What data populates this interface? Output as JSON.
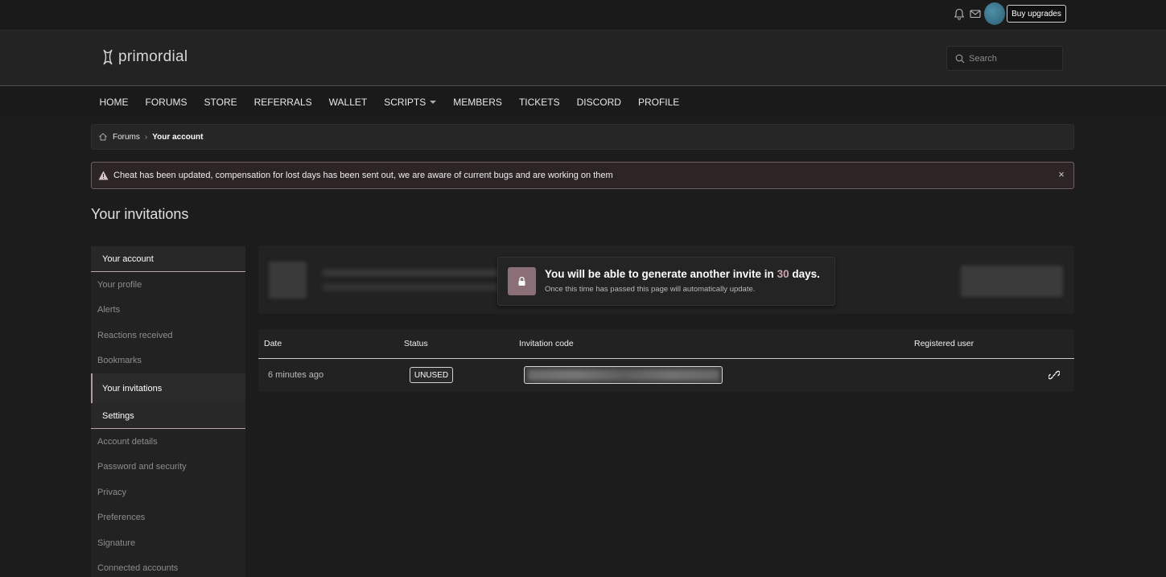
{
  "topbar": {
    "buy_label": "Buy upgrades"
  },
  "header": {
    "logo_text": "primordial",
    "search_placeholder": "Search"
  },
  "nav": {
    "items": [
      "HOME",
      "FORUMS",
      "STORE",
      "REFERRALS",
      "WALLET",
      "SCRIPTS",
      "MEMBERS",
      "TICKETS",
      "DISCORD",
      "PROFILE"
    ]
  },
  "breadcrumb": {
    "forums": "Forums",
    "current": "Your account"
  },
  "notice": {
    "text": "Cheat has been updated, compensation for lost days has been sent out, we are aware of current bugs and are working on them",
    "close": "×"
  },
  "page": {
    "title": "Your invitations"
  },
  "sidebar": {
    "account_header": "Your account",
    "account_items": [
      "Your profile",
      "Alerts",
      "Reactions received",
      "Bookmarks",
      "Your invitations"
    ],
    "settings_header": "Settings",
    "settings_items": [
      "Account details",
      "Password and security",
      "Privacy",
      "Preferences",
      "Signature",
      "Connected accounts"
    ]
  },
  "tooltip": {
    "line1_prefix": "You will be able to generate another invite in ",
    "days": "30",
    "line1_suffix": " days.",
    "line2": "Once this time has passed this page will automatically update."
  },
  "table": {
    "headers": {
      "date": "Date",
      "status": "Status",
      "code": "Invitation code",
      "user": "Registered user"
    },
    "rows": [
      {
        "date": "6 minutes ago",
        "status": "UNUSED"
      }
    ]
  },
  "colors": {
    "accent": "#8b6f76",
    "accent_text": "#c9a6ad",
    "background": "#1c1c1c"
  },
  "icons": [
    "bell-icon",
    "mail-icon",
    "search-icon",
    "home-icon",
    "warning-icon",
    "close-icon",
    "lock-icon",
    "link-icon",
    "logo-icon"
  ]
}
